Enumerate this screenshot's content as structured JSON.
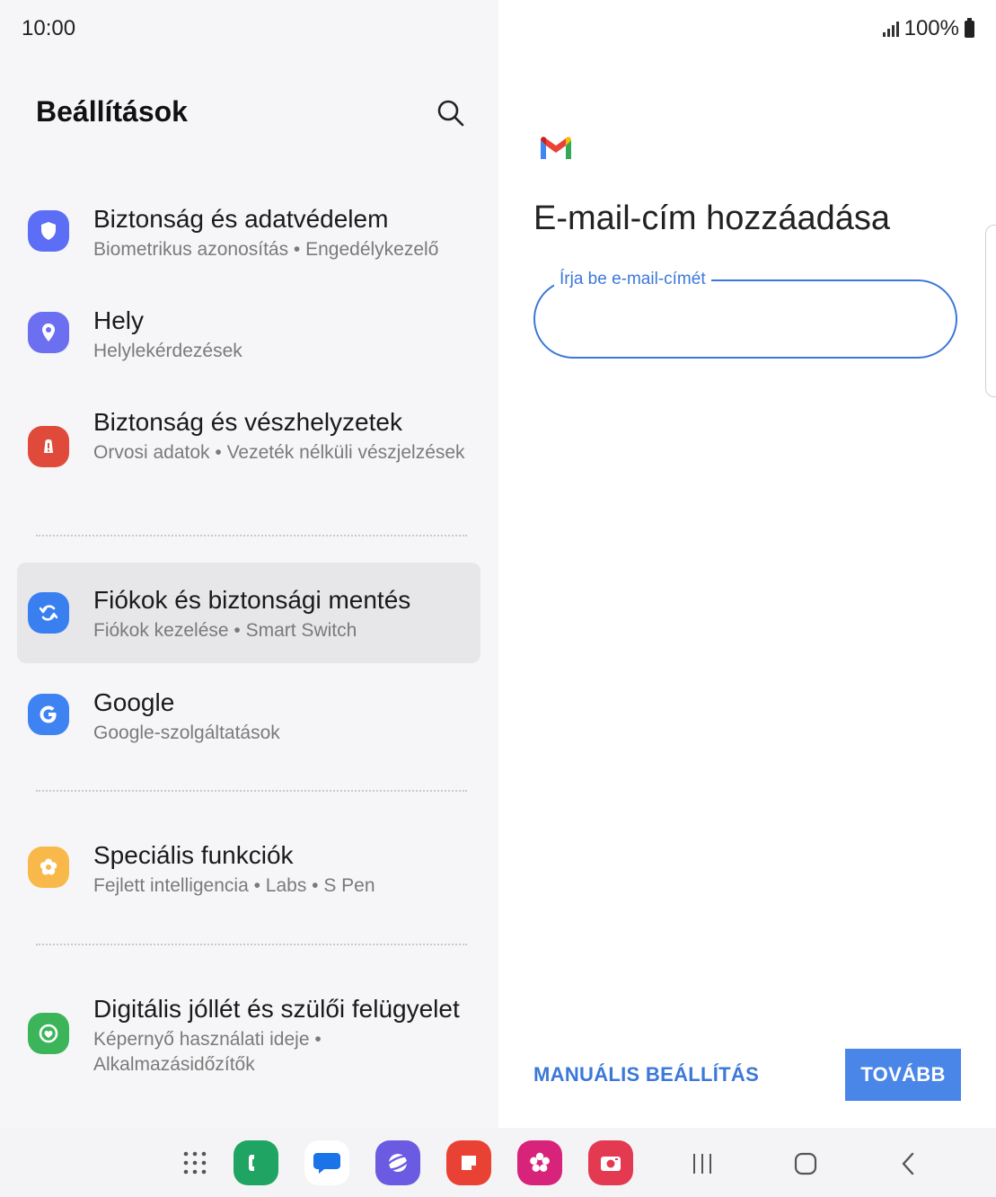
{
  "status_bar": {
    "time": "10:00",
    "battery": "100%"
  },
  "settings": {
    "title": "Beállítások",
    "items": [
      {
        "title": "Biztonság és adatvédelem",
        "subtitle": "Biometrikus azonosítás  •  Engedélykezelő",
        "icon": "shield-icon",
        "color": "#5b6ef5"
      },
      {
        "title": "Hely",
        "subtitle": "Helylekérdezések",
        "icon": "location-pin-icon",
        "color": "#6b6ff0"
      },
      {
        "title": "Biztonság és vészhelyzetek",
        "subtitle": "Orvosi adatok  •  Vezeték nélküli vészjelzések",
        "icon": "emergency-icon",
        "color": "#e04a3a"
      },
      {
        "title": "Fiókok és biztonsági mentés",
        "subtitle": "Fiókok kezelése  •  Smart Switch",
        "icon": "sync-icon",
        "color": "#3a7ff0",
        "active": true
      },
      {
        "title": "Google",
        "subtitle": "Google-szolgáltatások",
        "icon": "google-icon",
        "color": "#3f82f2"
      },
      {
        "title": "Speciális funkciók",
        "subtitle": "Fejlett intelligencia  •  Labs  •  S Pen",
        "icon": "flower-icon",
        "color": "#f8b84a"
      },
      {
        "title": "Digitális jóllét és szülői felügyelet",
        "subtitle": "Képernyő használati ideje  •  Alkalmazásidőzítők",
        "icon": "wellbeing-icon",
        "color": "#3cb55a"
      }
    ]
  },
  "email_setup": {
    "title": "E-mail-cím hozzáadása",
    "input_label": "Írja be e-mail-címét",
    "input_value": "",
    "manual_button": "MANUÁLIS BEÁLLÍTÁS",
    "next_button": "TOVÁBB",
    "accent_color": "#3b78d8"
  },
  "taskbar": {
    "apps": [
      "apps-grid-icon",
      "phone-icon",
      "messages-icon",
      "internet-icon",
      "notes-icon",
      "gallery-icon",
      "camera-icon"
    ],
    "nav": [
      "recents-icon",
      "home-icon",
      "back-icon"
    ]
  }
}
